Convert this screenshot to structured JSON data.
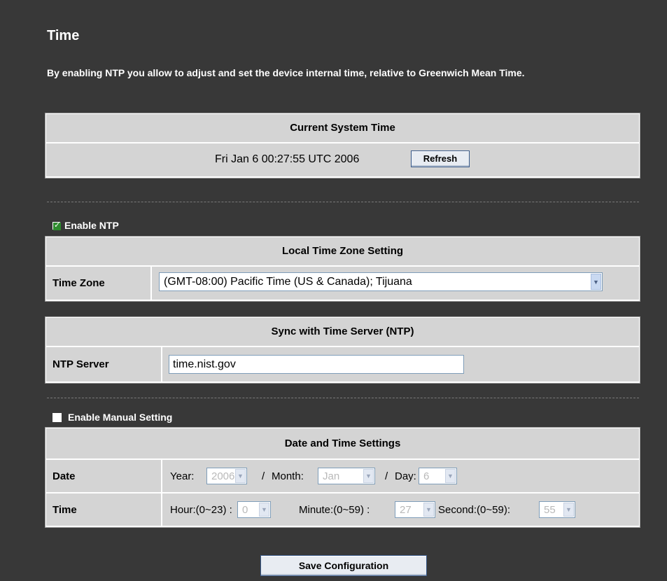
{
  "page": {
    "title": "Time",
    "intro": "By enabling NTP you allow to adjust and set the device internal time, relative to Greenwich Mean Time."
  },
  "current_time": {
    "header": "Current System Time",
    "value": "Fri Jan 6 00:27:55 UTC 2006",
    "refresh_label": "Refresh"
  },
  "ntp": {
    "enable_label": "Enable NTP",
    "enabled": true,
    "timezone_header": "Local Time Zone Setting",
    "timezone_label": "Time Zone",
    "timezone_value": "(GMT-08:00) Pacific Time (US & Canada); Tijuana",
    "sync_header": "Sync with Time Server (NTP)",
    "server_label": "NTP Server",
    "server_value": "time.nist.gov"
  },
  "manual": {
    "enable_label": "Enable Manual Setting",
    "enabled": false,
    "header": "Date and Time Settings",
    "date_label": "Date",
    "time_label": "Time",
    "year_label": "Year:",
    "year_value": "2006",
    "month_sep": "/",
    "month_label": "Month:",
    "month_value": "Jan",
    "day_sep": "/",
    "day_label": "Day:",
    "day_value": "6",
    "hour_label": "Hour:(0~23) :",
    "hour_value": "0",
    "minute_label": "Minute:(0~59) :",
    "minute_value": "27",
    "second_label": "Second:(0~59):",
    "second_value": "55"
  },
  "actions": {
    "save_label": "Save Configuration"
  },
  "colors": {
    "panel_bg": "#383838",
    "table_bg": "#d4d4d4",
    "checkbox_checked": "#2e8b2e"
  }
}
